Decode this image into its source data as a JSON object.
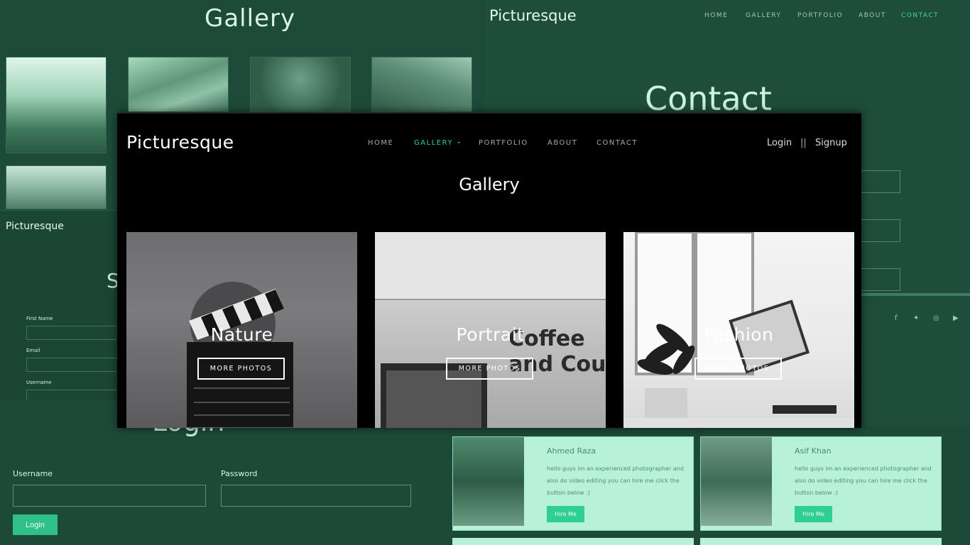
{
  "gallery_panel": {
    "title": "Gallery"
  },
  "contact_panel": {
    "brand": "Picturesque",
    "nav": [
      "HOME",
      "GALLERY",
      "PORTFOLIO",
      "ABOUT",
      "CONTACT"
    ],
    "heading": "Contact",
    "social_icons": [
      "facebook-icon",
      "twitter-icon",
      "instagram-icon",
      "youtube-icon"
    ]
  },
  "signup_panel": {
    "brand": "Picturesque",
    "heading_partial": "S",
    "fields": [
      "First Name",
      "Email",
      "Username"
    ]
  },
  "login_panel": {
    "heading_partial": "Login",
    "username_label": "Username",
    "password_label": "Password",
    "login_button": "Login"
  },
  "profiles": [
    {
      "name": "Ahmed Raza",
      "desc": "hello guys im an experienced photographer and also do video editing you can hire me click the button below :)",
      "button": "Hire Me"
    },
    {
      "name": "Asif Khan",
      "desc": "hello guys im an experienced photographer and also do video editing you can hire me click the button below :)",
      "button": "Hire Me"
    }
  ],
  "main": {
    "brand": "Picturesque",
    "nav": {
      "home": "HOME",
      "gallery": "GALLERY",
      "portfolio": "PORTFOLIO",
      "about": "ABOUT",
      "contact": "CONTACT"
    },
    "login": "Login",
    "separator": "||",
    "signup": "Signup",
    "page_title": "Gallery",
    "categories": [
      {
        "caption": "Nature",
        "button": "MORE PHOTOS"
      },
      {
        "caption": "Portrait",
        "button": "MORE PHOTOS"
      },
      {
        "caption": "Fashion",
        "button": "MORE PHOTOS"
      }
    ],
    "accent": "#32d28c"
  }
}
